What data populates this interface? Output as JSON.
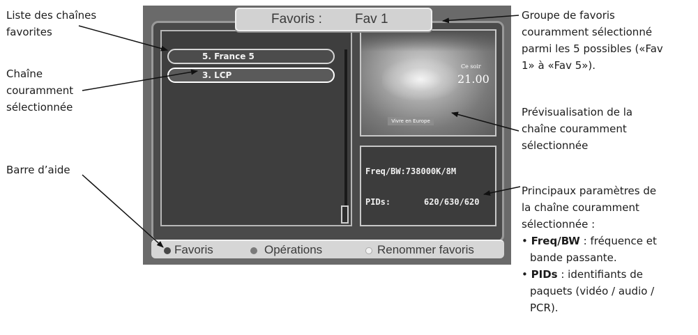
{
  "screen": {
    "group_label": "Favoris :",
    "group_value": "Fav 1",
    "channels": [
      {
        "label": "5. France 5"
      },
      {
        "label": "3. LCP"
      }
    ],
    "preview": {
      "ce_soir": "Ce soir",
      "time": "21.00",
      "banner": "Vivre en Europe"
    },
    "info": {
      "freq": "Freq/BW:738000K/8M",
      "pids_label": "PIDs:",
      "pids_value": "620/630/620"
    },
    "helpbar": {
      "favoris": "Favoris",
      "operations": "Opérations",
      "renommer": "Renommer favoris"
    }
  },
  "annotations": {
    "left_1": [
      "Liste des chaînes",
      "favorites"
    ],
    "left_2": [
      "Chaîne",
      "couramment",
      "sélectionnée"
    ],
    "left_3": "Barre d’aide",
    "right_1": [
      "Groupe de favoris",
      "couramment sélectionné",
      "parmi les 5 possibles («Fav",
      "1» à «Fav 5»)."
    ],
    "right_2": [
      "Prévisualisation de la",
      "chaîne couramment",
      "sélectionnée"
    ],
    "right_3": [
      "Principaux paramètres de",
      "la chaîne couramment",
      "sélectionnée :"
    ],
    "bullet_freq": {
      "term": "Freq/BW",
      "rest_1": " : fréquence et",
      "rest_2": "bande passante."
    },
    "bullet_pids": {
      "term": "PIDs",
      "rest_1": " : identifiants de",
      "rest_2": "paquets (vidéo / audio /",
      "rest_3": "PCR)."
    }
  },
  "colors": {
    "screen_bg": "#6a6a6a",
    "panel_bg": "#3e3e3e",
    "tab_bg": "#d2d2d2"
  }
}
